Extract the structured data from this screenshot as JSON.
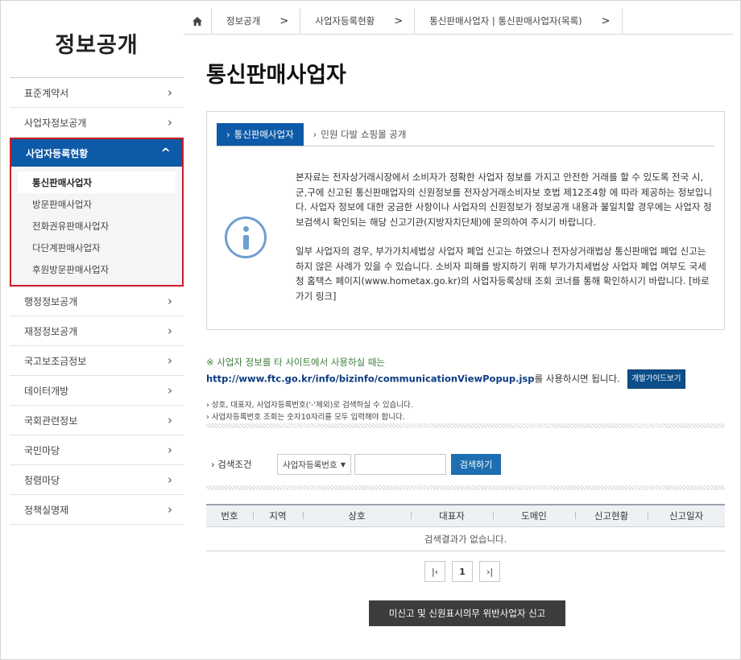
{
  "sidebar": {
    "title": "정보공개",
    "items_top": [
      {
        "label": "표준계약서"
      },
      {
        "label": "사업자정보공개"
      }
    ],
    "open_item": {
      "label": "사업자등록현황"
    },
    "subitems": [
      {
        "label": "통신판매사업자"
      },
      {
        "label": "방문판매사업자"
      },
      {
        "label": "전화권유판매사업자"
      },
      {
        "label": "다단계판매사업자"
      },
      {
        "label": "후원방문판매사업자"
      }
    ],
    "items_bottom": [
      {
        "label": "행정정보공개"
      },
      {
        "label": "재정정보공개"
      },
      {
        "label": "국고보조금정보"
      },
      {
        "label": "데이터개방"
      },
      {
        "label": "국회관련정보"
      },
      {
        "label": "국민마당"
      },
      {
        "label": "청렴마당"
      },
      {
        "label": "정책실명제"
      }
    ],
    "chevron_right": "›",
    "chevron_up": "^"
  },
  "breadcrumb": {
    "items": [
      "정보공개",
      "사업자등록현황",
      "통신판매사업자 | 통신판매사업자(목록)"
    ],
    "sep": ">"
  },
  "page_title": "통신판매사업자",
  "tabs": [
    {
      "label": "통신판매사업자",
      "arrow": "›"
    },
    {
      "label": "민원 다발 쇼핑몰 공개",
      "arrow": "›"
    }
  ],
  "info": {
    "p1": "본자료는 전자상거래시장에서 소비자가 정확한 사업자 정보를 가지고 안전한 거래를 할 수 있도록 전국 시,군,구에 신고된 통신판매업자의 신원정보를 전자상거래소비자보 호법 제12조4항 에 따라 제공하는 정보입니다. 사업자 정보에 대한 궁금한 사항이나 사업자의 신원정보가 정보공개 내용과 불일치할 경우에는 사업자 정보검색시 확인되는 해당 신고기관(지방자치단체)에 문의하여 주시기 바랍니다.",
    "p2": "일부 사업자의 경우, 부가가치세법상 사업자 폐업 신고는 하였으나 전자상거래법상 통신판매업 폐업 신고는 하지 않은 사례가 있을 수 있습니다. 소비자 피해를 방지하기 위해 부가가치세법상 사업자 폐업 여부도 국세청 홈택스 페이지(www.hometax.go.kr)의 사업자등록상태 조회 코너를 통해 확인하시기 바랍니다. [바로가기 링크]"
  },
  "notice": {
    "line1": "※ 사업자 정보를 타 사이트에서 사용하실 때는",
    "url": "http://www.ftc.go.kr/info/bizinfo/communicationViewPopup.jsp",
    "suffix": "를 사용하시면 됩니다.",
    "guide_button": "개발가이드보기"
  },
  "hints": [
    "› 상호, 대표자, 사업자등록번호('-'제외)로 검색하실 수 있습니다.",
    "› 사업자등록번호 조회는 숫자10자리를 모두 입력해야 합니다."
  ],
  "search": {
    "label": "› 검색조건",
    "select_value": "사업자등록번호",
    "select_arrow": "▼",
    "input_value": "",
    "button": "검색하기"
  },
  "table": {
    "columns": [
      "번호",
      "지역",
      "상호",
      "대표자",
      "도메인",
      "신고현황",
      "신고일자"
    ],
    "empty_message": "검색결과가 없습니다."
  },
  "pager": {
    "first": "|‹",
    "current": "1",
    "last": "›|"
  },
  "report_button": "미신고 및 신원표시의무 위반사업자 신고"
}
